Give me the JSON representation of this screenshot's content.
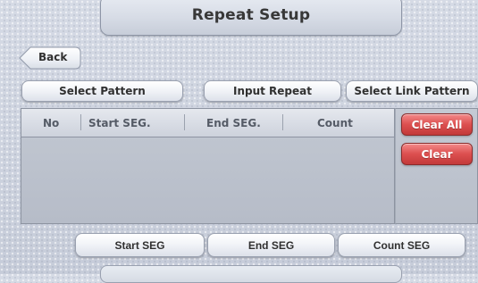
{
  "header": {
    "title": "Repeat Setup"
  },
  "nav": {
    "back_label": "Back"
  },
  "toolbar": {
    "select_pattern_label": "Select Pattern",
    "input_repeat_label": "Input Repeat",
    "select_link_pattern_label": "Select Link Pattern"
  },
  "table": {
    "columns": [
      "No",
      "Start SEG.",
      "End SEG.",
      "Count"
    ],
    "rows": []
  },
  "side_actions": {
    "clear_all_label": "Clear All",
    "clear_label": "Clear"
  },
  "segment_actions": {
    "start_seg_label": "Start SEG",
    "end_seg_label": "End SEG",
    "count_seg_label": "Count SEG"
  },
  "colors": {
    "background": "#cad0dd",
    "danger_button": "#dc4f4f",
    "panel": "#b6bcc8",
    "button": "#f2f4f8"
  }
}
